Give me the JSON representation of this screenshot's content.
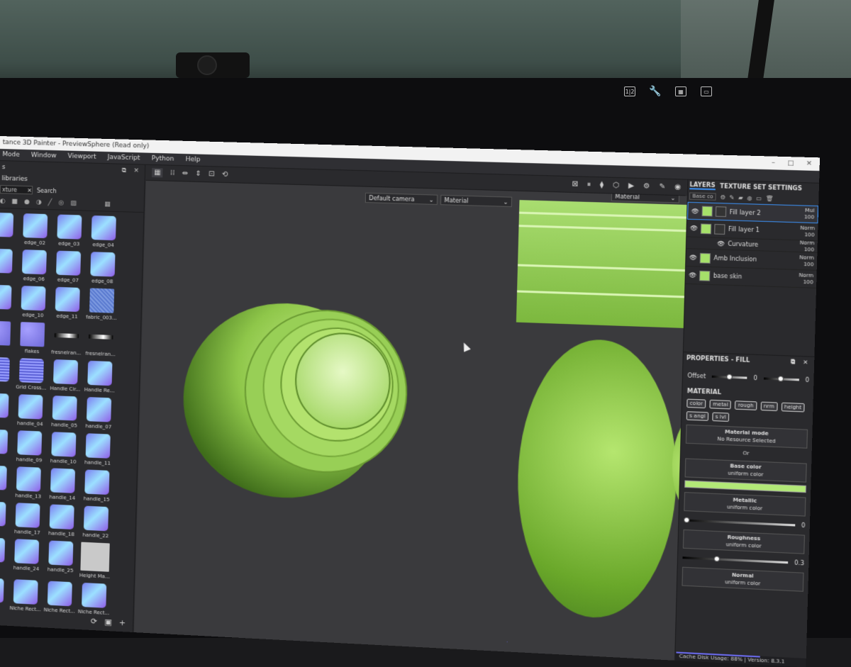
{
  "app": {
    "title": "tance 3D Painter - PreviewSphere (Read only)"
  },
  "menu": [
    "Mode",
    "Window",
    "Viewport",
    "JavaScript",
    "Python",
    "Help"
  ],
  "shelf": {
    "panel_label": "s",
    "title": "libraries",
    "search_value": "xture",
    "search_label": "Search",
    "assets": [
      {
        "label": "",
        "icon": "edge-thumb"
      },
      {
        "label": "edge_02",
        "icon": "edge-thumb"
      },
      {
        "label": "edge_03",
        "icon": "edge-thumb"
      },
      {
        "label": "edge_04",
        "icon": "edge-thumb"
      },
      {
        "label": "",
        "icon": "edge-thumb"
      },
      {
        "label": "edge_06",
        "icon": "edge-thumb"
      },
      {
        "label": "edge_07",
        "icon": "edge-thumb"
      },
      {
        "label": "edge_08",
        "icon": "edge-thumb"
      },
      {
        "label": "",
        "icon": "edge-thumb"
      },
      {
        "label": "edge_10",
        "icon": "edge-thumb"
      },
      {
        "label": "edge_11",
        "icon": "edge-thumb"
      },
      {
        "label": "fabric_003...",
        "icon": "fabric-thumb"
      },
      {
        "label": "",
        "icon": "flakes-thumb"
      },
      {
        "label": "flakes",
        "icon": "flakes-thumb"
      },
      {
        "label": "fresnelran...",
        "icon": "gradient-thumb"
      },
      {
        "label": "fresnelran...",
        "icon": "gradient-thumb"
      },
      {
        "label": "",
        "icon": "grid-thumb"
      },
      {
        "label": "Grid Cross...",
        "icon": "grid-thumb"
      },
      {
        "label": "Handle Cir...",
        "icon": "handle-thumb"
      },
      {
        "label": "Handle Re...",
        "icon": "handle-thumb"
      },
      {
        "label": "",
        "icon": "handle-thumb"
      },
      {
        "label": "handle_04",
        "icon": "handle-thumb"
      },
      {
        "label": "handle_05",
        "icon": "handle-thumb"
      },
      {
        "label": "handle_07",
        "icon": "handle-thumb"
      },
      {
        "label": "",
        "icon": "handle-thumb"
      },
      {
        "label": "handle_09",
        "icon": "handle-thumb"
      },
      {
        "label": "handle_10",
        "icon": "handle-thumb"
      },
      {
        "label": "handle_11",
        "icon": "handle-thumb"
      },
      {
        "label": "",
        "icon": "handle-thumb"
      },
      {
        "label": "handle_13",
        "icon": "handle-thumb"
      },
      {
        "label": "handle_14",
        "icon": "handle-thumb"
      },
      {
        "label": "handle_15",
        "icon": "handle-thumb"
      },
      {
        "label": "",
        "icon": "handle-thumb"
      },
      {
        "label": "handle_17",
        "icon": "handle-thumb"
      },
      {
        "label": "handle_18",
        "icon": "handle-thumb"
      },
      {
        "label": "handle_22",
        "icon": "handle-thumb"
      },
      {
        "label": "",
        "icon": "handle-thumb"
      },
      {
        "label": "handle_24",
        "icon": "handle-thumb"
      },
      {
        "label": "handle_25",
        "icon": "handle-thumb"
      },
      {
        "label": "Height Ma...",
        "icon": "height-thumb"
      },
      {
        "label": "",
        "icon": "niche-thumb"
      },
      {
        "label": "Niche Rect...",
        "icon": "niche-thumb"
      },
      {
        "label": "Niche Rect...",
        "icon": "niche-thumb"
      },
      {
        "label": "Niche Rect...",
        "icon": "niche-thumb"
      }
    ]
  },
  "viewport": {
    "camera_value": "Default camera",
    "mode_value": "Material",
    "mode_value_2d": "Material"
  },
  "layers": {
    "tab_layers": "LAYERS",
    "tab_tss": "TEXTURE SET SETTINGS",
    "channel_select": "Base co",
    "items": [
      {
        "name": "Fill layer 2",
        "blend": "Mul",
        "opacity": "100"
      },
      {
        "name": "Fill layer 1",
        "blend": "Norm",
        "opacity": "100"
      },
      {
        "name": "Curvature",
        "blend": "Norm",
        "opacity": "100"
      },
      {
        "name": "Amb Inclusion",
        "blend": "Norm",
        "opacity": "100"
      },
      {
        "name": "base skin",
        "blend": "Norm",
        "opacity": "100"
      }
    ]
  },
  "properties": {
    "title": "PROPERTIES - FILL",
    "offset_label": "Offset",
    "offset_values": [
      "0",
      "0"
    ],
    "material_title": "MATERIAL",
    "channels": [
      "color",
      "metal",
      "rough",
      "nrm",
      "height",
      "s angl",
      "s lvl"
    ],
    "material_mode_label": "Material mode",
    "material_mode_value": "No Resource Selected",
    "or_label": "Or",
    "base_color_label": "Base color",
    "base_color_value": "uniform color",
    "base_color_hex": "#b2e877",
    "metallic_label": "Metallic",
    "metallic_value": "uniform color",
    "metallic_amount": "0",
    "roughness_label": "Roughness",
    "roughness_value": "uniform color",
    "roughness_amount": "0.3",
    "normal_label": "Normal",
    "normal_value": "uniform color"
  },
  "status": {
    "cache": "Cache Disk Usage:",
    "percent": "88%",
    "version": "| Version: 8.3.1"
  }
}
